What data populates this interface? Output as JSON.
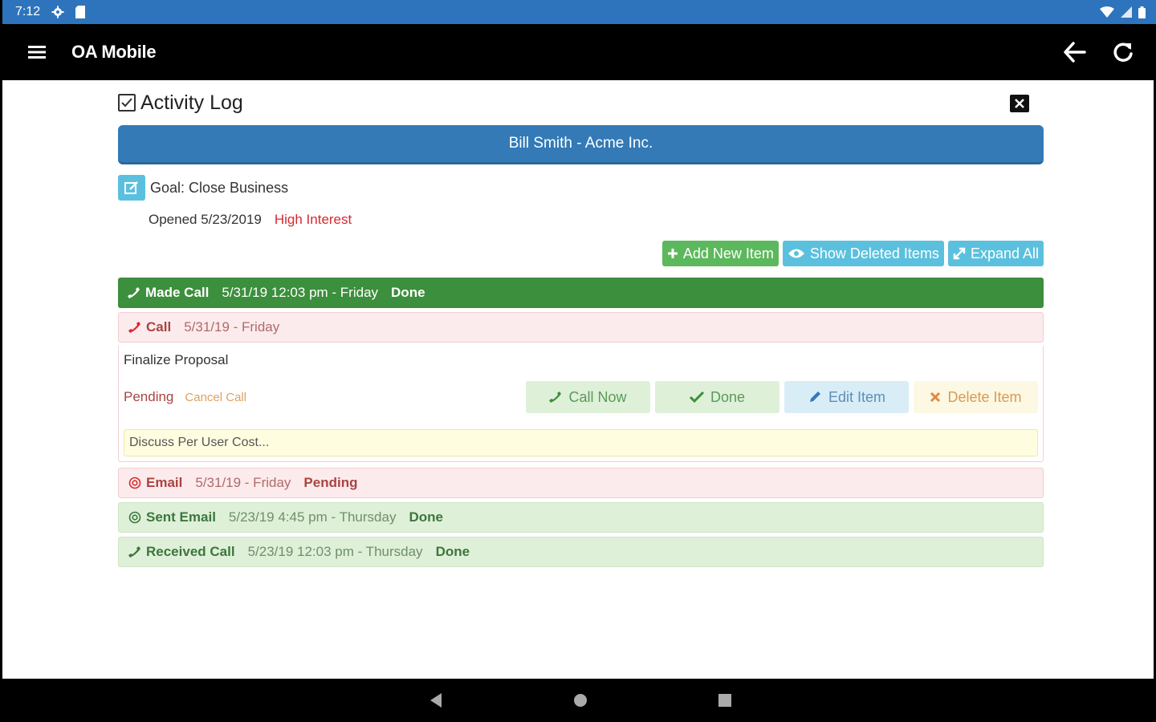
{
  "status_bar": {
    "time": "7:12"
  },
  "app_bar": {
    "title": "OA Mobile"
  },
  "header": {
    "title": "Activity Log"
  },
  "contact": {
    "label": "Bill Smith - Acme Inc."
  },
  "goal": {
    "text": "Goal: Close Business",
    "opened": "Opened 5/23/2019",
    "interest": "High Interest"
  },
  "toolbar": {
    "add_label": "Add New Item",
    "show_deleted_label": "Show Deleted Items",
    "expand_label": "Expand All"
  },
  "activities": {
    "made_call": {
      "type": "Made Call",
      "datetime": "5/31/19 12:03 pm - Friday",
      "status": "Done"
    },
    "call": {
      "type": "Call",
      "datetime": "5/31/19 - Friday",
      "detail": {
        "title": "Finalize Proposal",
        "status": "Pending",
        "cancel": "Cancel Call",
        "buttons": {
          "call_now": "Call Now",
          "done": "Done",
          "edit": "Edit Item",
          "delete": "Delete Item"
        },
        "note": "Discuss Per User Cost..."
      }
    },
    "email": {
      "type": "Email",
      "datetime": "5/31/19 - Friday",
      "status": "Pending"
    },
    "sent_email": {
      "type": "Sent Email",
      "datetime": "5/23/19 4:45 pm - Thursday",
      "status": "Done"
    },
    "received_call": {
      "type": "Received Call",
      "datetime": "5/23/19 12:03 pm - Thursday",
      "status": "Done"
    }
  },
  "colors": {
    "primary": "#337ab7",
    "success": "#5cb85c",
    "info": "#5bc0de",
    "danger": "#d9272e",
    "made_call_bg": "#3c8f3c"
  }
}
